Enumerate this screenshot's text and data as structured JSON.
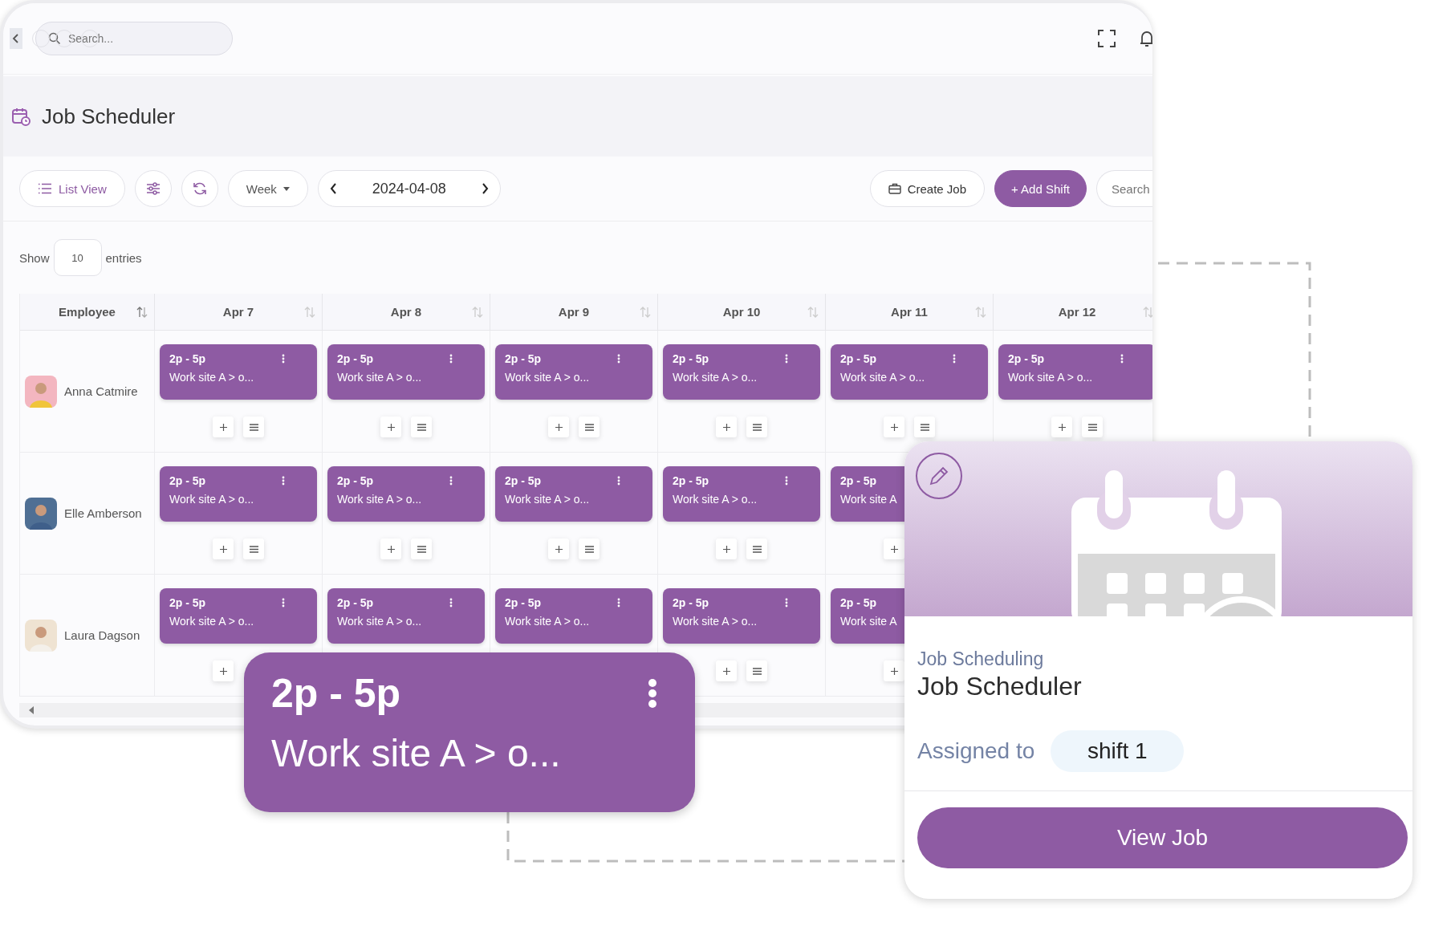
{
  "top_bar": {
    "search": {
      "placeholder": "Search..."
    }
  },
  "page": {
    "title": "Job Scheduler"
  },
  "toolbar": {
    "view_button": "List View",
    "range": "Week",
    "date": "2024-04-08",
    "create_button": "Create Job",
    "add_button": "+ Add Shift",
    "search": {
      "placeholder": "Search"
    }
  },
  "entries": {
    "before": "Show",
    "value": "10",
    "after": "entries"
  },
  "table": {
    "columns": [
      "Employee",
      "Apr 7",
      "Apr 8",
      "Apr 9",
      "Apr 10",
      "Apr 11",
      "Apr 12"
    ],
    "rows": [
      {
        "cells": [
          {
            "kind": "employee",
            "name": "Anna Catmire"
          },
          {
            "kind": "shift",
            "time": "2p - 5p",
            "site": "Work site A > o...",
            "menu": true,
            "add": true,
            "list": true
          },
          {
            "kind": "shift",
            "time": "2p - 5p",
            "site": "Work site A > o...",
            "menu": true,
            "add": true,
            "list": true
          },
          {
            "kind": "shift",
            "time": "2p - 5p",
            "site": "Work site A > o...",
            "menu": true,
            "add": true,
            "list": true
          },
          {
            "kind": "shift",
            "time": "2p - 5p",
            "site": "Work site A > o...",
            "menu": true,
            "add": true,
            "list": true
          },
          {
            "kind": "shift",
            "time": "2p - 5p",
            "site": "Work site A > o...",
            "menu": true,
            "add": true,
            "list": true
          },
          {
            "kind": "shift",
            "time": "2p - 5p",
            "site": "Work site A > o...",
            "menu": true,
            "add": true,
            "list": true
          }
        ]
      },
      {
        "cells": [
          {
            "kind": "employee",
            "name": "Elle Amberson"
          },
          {
            "kind": "shift",
            "time": "2p - 5p",
            "site": "Work site A > o...",
            "menu": true,
            "add": true,
            "list": true
          },
          {
            "kind": "shift",
            "time": "2p - 5p",
            "site": "Work site A > o...",
            "menu": true,
            "add": true,
            "list": true
          },
          {
            "kind": "shift",
            "time": "2p - 5p",
            "site": "Work site A > o...",
            "menu": true,
            "add": true,
            "list": true
          },
          {
            "kind": "shift",
            "time": "2p - 5p",
            "site": "Work site A > o...",
            "menu": true,
            "add": true,
            "list": true
          },
          {
            "kind": "shift",
            "time": "2p - 5p",
            "site": "Work site A",
            "menu": false,
            "add": true,
            "list": false
          },
          {
            "kind": "empty"
          }
        ]
      },
      {
        "cells": [
          {
            "kind": "employee",
            "name": "Laura Dagson"
          },
          {
            "kind": "shift",
            "time": "2p - 5p",
            "site": "Work site A > o...",
            "menu": true,
            "add": true,
            "list": false
          },
          {
            "kind": "shift",
            "time": "2p - 5p",
            "site": "Work site A > o...",
            "menu": true,
            "add": false,
            "list": false
          },
          {
            "kind": "shift",
            "time": "2p - 5p",
            "site": "Work site A > o...",
            "menu": true,
            "add": false,
            "list": false
          },
          {
            "kind": "shift",
            "time": "2p - 5p",
            "site": "Work site A > o...",
            "menu": true,
            "add": true,
            "list": true
          },
          {
            "kind": "shift",
            "time": "2p - 5p",
            "site": "Work site A",
            "menu": false,
            "add": true,
            "list": false
          },
          {
            "kind": "empty"
          }
        ]
      }
    ]
  },
  "callout": {
    "time": "2p - 5p",
    "site": "Work site A > o..."
  },
  "card": {
    "category": "Job Scheduling",
    "title": "Job Scheduler",
    "assigned_label": "Assigned to",
    "assigned_value": "shift 1",
    "button": "View Job"
  }
}
